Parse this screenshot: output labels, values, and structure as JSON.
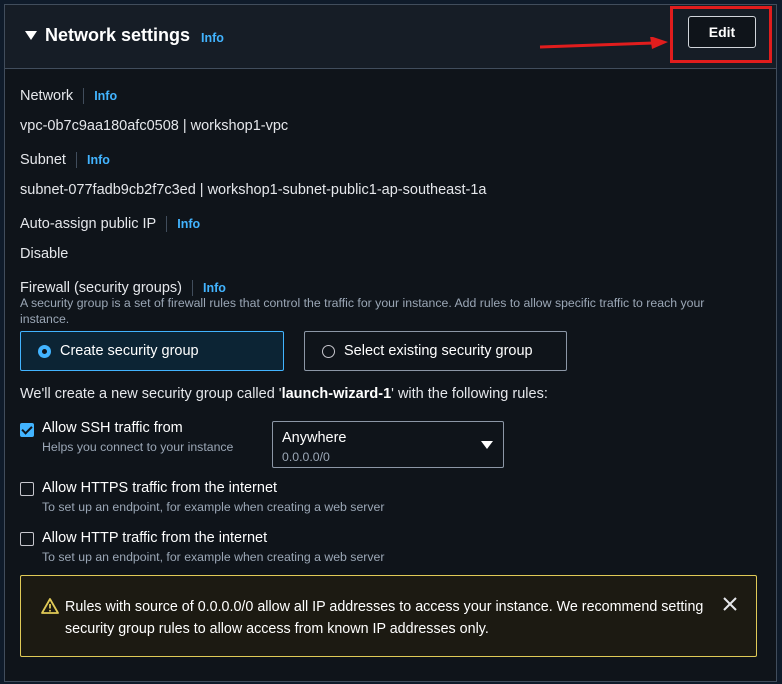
{
  "header": {
    "title": "Network settings",
    "info": "Info",
    "edit_label": "Edit"
  },
  "fields": {
    "network": {
      "label": "Network",
      "info": "Info",
      "value": "vpc-0b7c9aa180afc0508 | workshop1-vpc"
    },
    "subnet": {
      "label": "Subnet",
      "info": "Info",
      "value": "subnet-077fadb9cb2f7c3ed | workshop1-subnet-public1-ap-southeast-1a"
    },
    "auto_ip": {
      "label": "Auto-assign public IP",
      "info": "Info",
      "value": "Disable"
    }
  },
  "firewall": {
    "label": "Firewall (security groups)",
    "info": "Info",
    "description": "A security group is a set of firewall rules that control the traffic for your instance. Add rules to allow specific traffic to reach your instance.",
    "options": [
      {
        "label": "Create security group",
        "selected": true
      },
      {
        "label": "Select existing security group",
        "selected": false
      }
    ],
    "sg_prefix": "We'll create a new security group called '",
    "sg_name": "launch-wizard-1",
    "sg_suffix": "' with the following rules:"
  },
  "rules": [
    {
      "label": "Allow SSH traffic from",
      "desc": "Helps you connect to your instance",
      "checked": true
    },
    {
      "label": "Allow HTTPS traffic from the internet",
      "desc": "To set up an endpoint, for example when creating a web server",
      "checked": false
    },
    {
      "label": "Allow HTTP traffic from the internet",
      "desc": "To set up an endpoint, for example when creating a web server",
      "checked": false
    }
  ],
  "ssh_source": {
    "value": "Anywhere",
    "sub": "0.0.0.0/0"
  },
  "alert": {
    "text": "Rules with source of 0.0.0.0/0 allow all IP addresses to access your instance. We recommend setting security group rules to allow access from known IP addresses only."
  },
  "colors": {
    "accent": "#42b4ff",
    "highlight": "#e11d1d",
    "warning": "#e0ca57"
  }
}
